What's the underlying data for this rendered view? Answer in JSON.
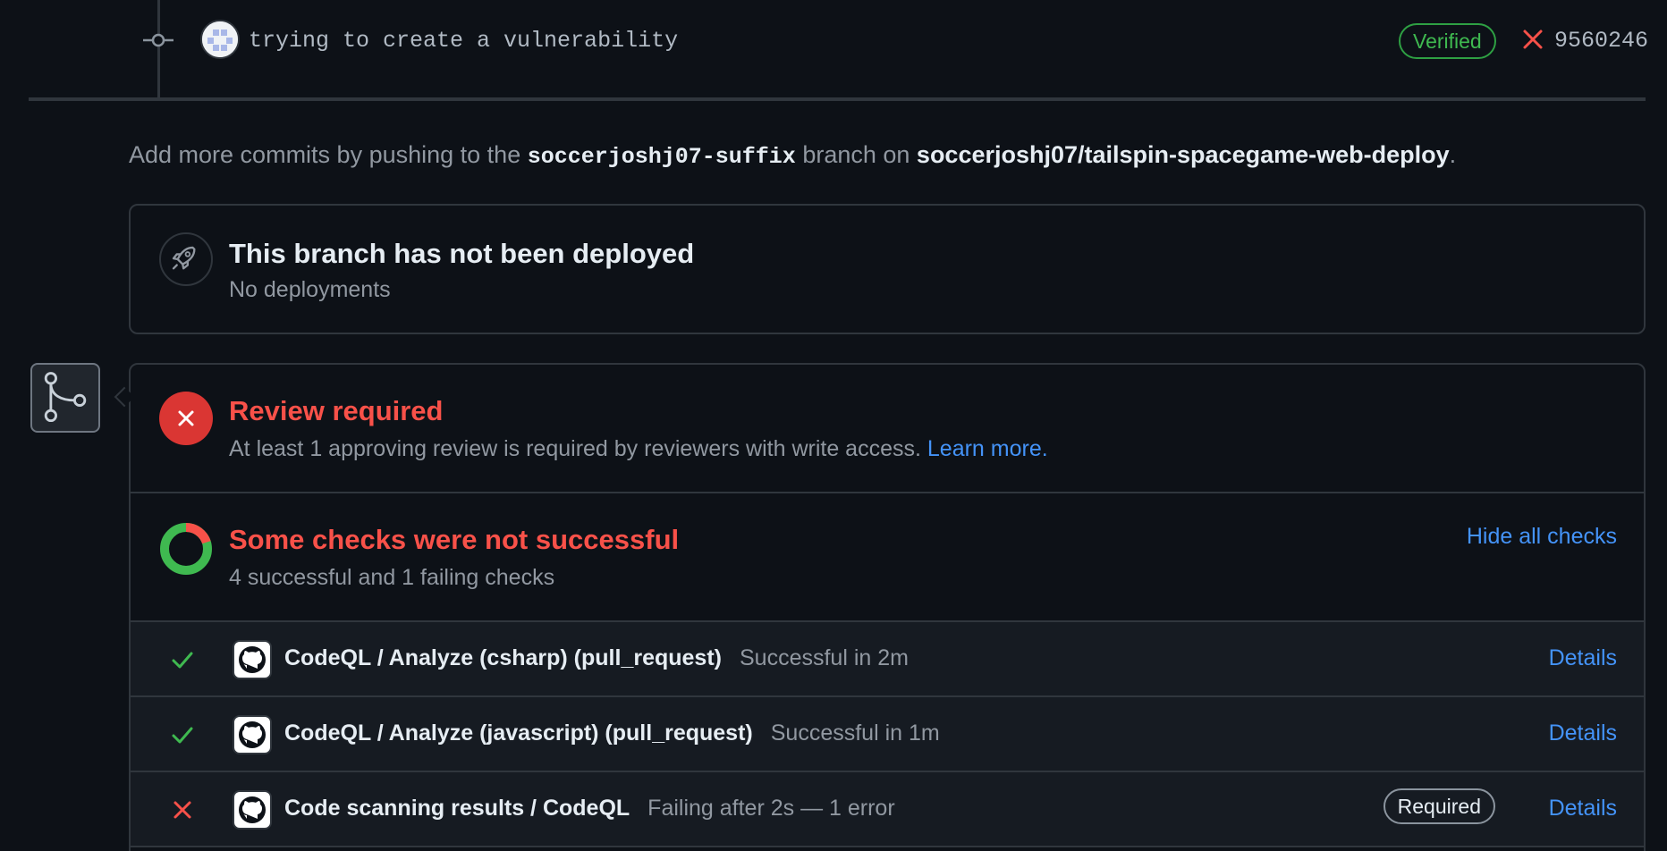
{
  "commit": {
    "message": "trying to create a vulnerability",
    "verified_label": "Verified",
    "sha": "9560246",
    "status": "failing"
  },
  "push_hint": {
    "prefix": "Add more commits by pushing to the",
    "branch": "soccerjoshj07-suffix",
    "middle": "branch on",
    "repo": "soccerjoshj07/tailspin-spacegame-web-deploy",
    "suffix": "."
  },
  "deployment": {
    "title": "This branch has not been deployed",
    "subtitle": "No deployments"
  },
  "review": {
    "title": "Review required",
    "description": "At least 1 approving review is required by reviewers with write access.",
    "link_label": "Learn more."
  },
  "checks_summary": {
    "title": "Some checks were not successful",
    "subtitle": "4 successful and 1 failing checks",
    "toggle_label": "Hide all checks",
    "successful": 4,
    "failing": 1
  },
  "checks": [
    {
      "status": "success",
      "name": "CodeQL / Analyze (csharp) (pull_request)",
      "description": "Successful in 2m",
      "details_label": "Details",
      "required_label": ""
    },
    {
      "status": "success",
      "name": "CodeQL / Analyze (javascript) (pull_request)",
      "description": "Successful in 1m",
      "details_label": "Details",
      "required_label": ""
    },
    {
      "status": "failure",
      "name": "Code scanning results / CodeQL",
      "description": "Failing after 2s — 1 error",
      "details_label": "Details",
      "required_label": "Required"
    }
  ],
  "colors": {
    "background": "#0d1117",
    "success": "#3fb950",
    "danger": "#f85149",
    "link": "#4493f8",
    "muted": "#9198a1"
  }
}
